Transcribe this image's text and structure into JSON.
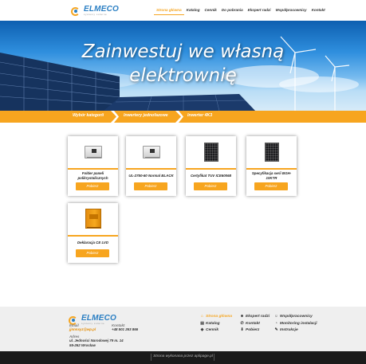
{
  "brand": {
    "name": "ELMECO",
    "tagline": "systemy solarne"
  },
  "nav": {
    "items": [
      {
        "label": "Strona główna",
        "active": true
      },
      {
        "label": "Katalog",
        "active": false
      },
      {
        "label": "Cennik",
        "active": false
      },
      {
        "label": "Do pobrania",
        "active": false
      },
      {
        "label": "Ekspert radzi",
        "active": false
      },
      {
        "label": "Współpracownicy",
        "active": false
      },
      {
        "label": "Kontakt",
        "active": false
      }
    ]
  },
  "hero": {
    "line1": "Zainwestuj we własną",
    "line2": "elektrownię"
  },
  "breadcrumb": {
    "items": [
      {
        "label": "Wybór kategorii"
      },
      {
        "label": "Inwertery jednofazowe"
      },
      {
        "label": "Inwerter 4K3"
      }
    ]
  },
  "products": [
    {
      "title": "Folder paneli polikrystalicznych",
      "button": "Pobierz",
      "icon": "inverter-icon"
    },
    {
      "title": "UL-2750-60 Normal BLACK",
      "button": "Pobierz",
      "icon": "inverter-icon"
    },
    {
      "title": "Certyfikat TUV ICE60068",
      "button": "Pobierz",
      "icon": "solar-panel-icon"
    },
    {
      "title": "Specyfikacja serii BGH-10KTR",
      "button": "Pobierz",
      "icon": "solar-panel-icon"
    },
    {
      "title": "Deklaracja CE LVD",
      "button": "Pobierz",
      "icon": "orange-inverter-icon"
    }
  ],
  "footer": {
    "email_label": "Email",
    "email_value": "jjnnnxyz@wp.pl",
    "phone_label": "Kontakt",
    "phone_value": "+48 501 263 866",
    "address_label": "Adres",
    "address_line1": "ul. Jedności Narodowej 79 m. 14",
    "address_line2": "55-262 Wrocław",
    "menu_col1": [
      {
        "label": "Strona główna",
        "icon": "home-icon",
        "active": true
      },
      {
        "label": "Katalog",
        "icon": "book-icon",
        "active": false
      },
      {
        "label": "Cennik",
        "icon": "price-tag-icon",
        "active": false
      }
    ],
    "menu_col2": [
      {
        "label": "Ekspert radzi",
        "icon": "expert-icon",
        "active": false
      },
      {
        "label": "Kontakt",
        "icon": "phone-icon",
        "active": false
      },
      {
        "label": "Pobierz",
        "icon": "download-icon",
        "active": false
      }
    ],
    "menu_col3": [
      {
        "label": "Współpracownicy",
        "icon": "people-icon",
        "active": false
      },
      {
        "label": "Monitoring instalacji",
        "icon": "monitor-icon",
        "active": false
      },
      {
        "label": "Instrukcje",
        "icon": "instructions-icon",
        "active": false
      }
    ]
  },
  "credit": "Strona wykonana przez aplipage.pl",
  "colors": {
    "accent": "#f7a51f",
    "brand_blue": "#2b7fc3",
    "footer_bg": "#efefef",
    "bottom_bar": "#1b1b1b"
  }
}
